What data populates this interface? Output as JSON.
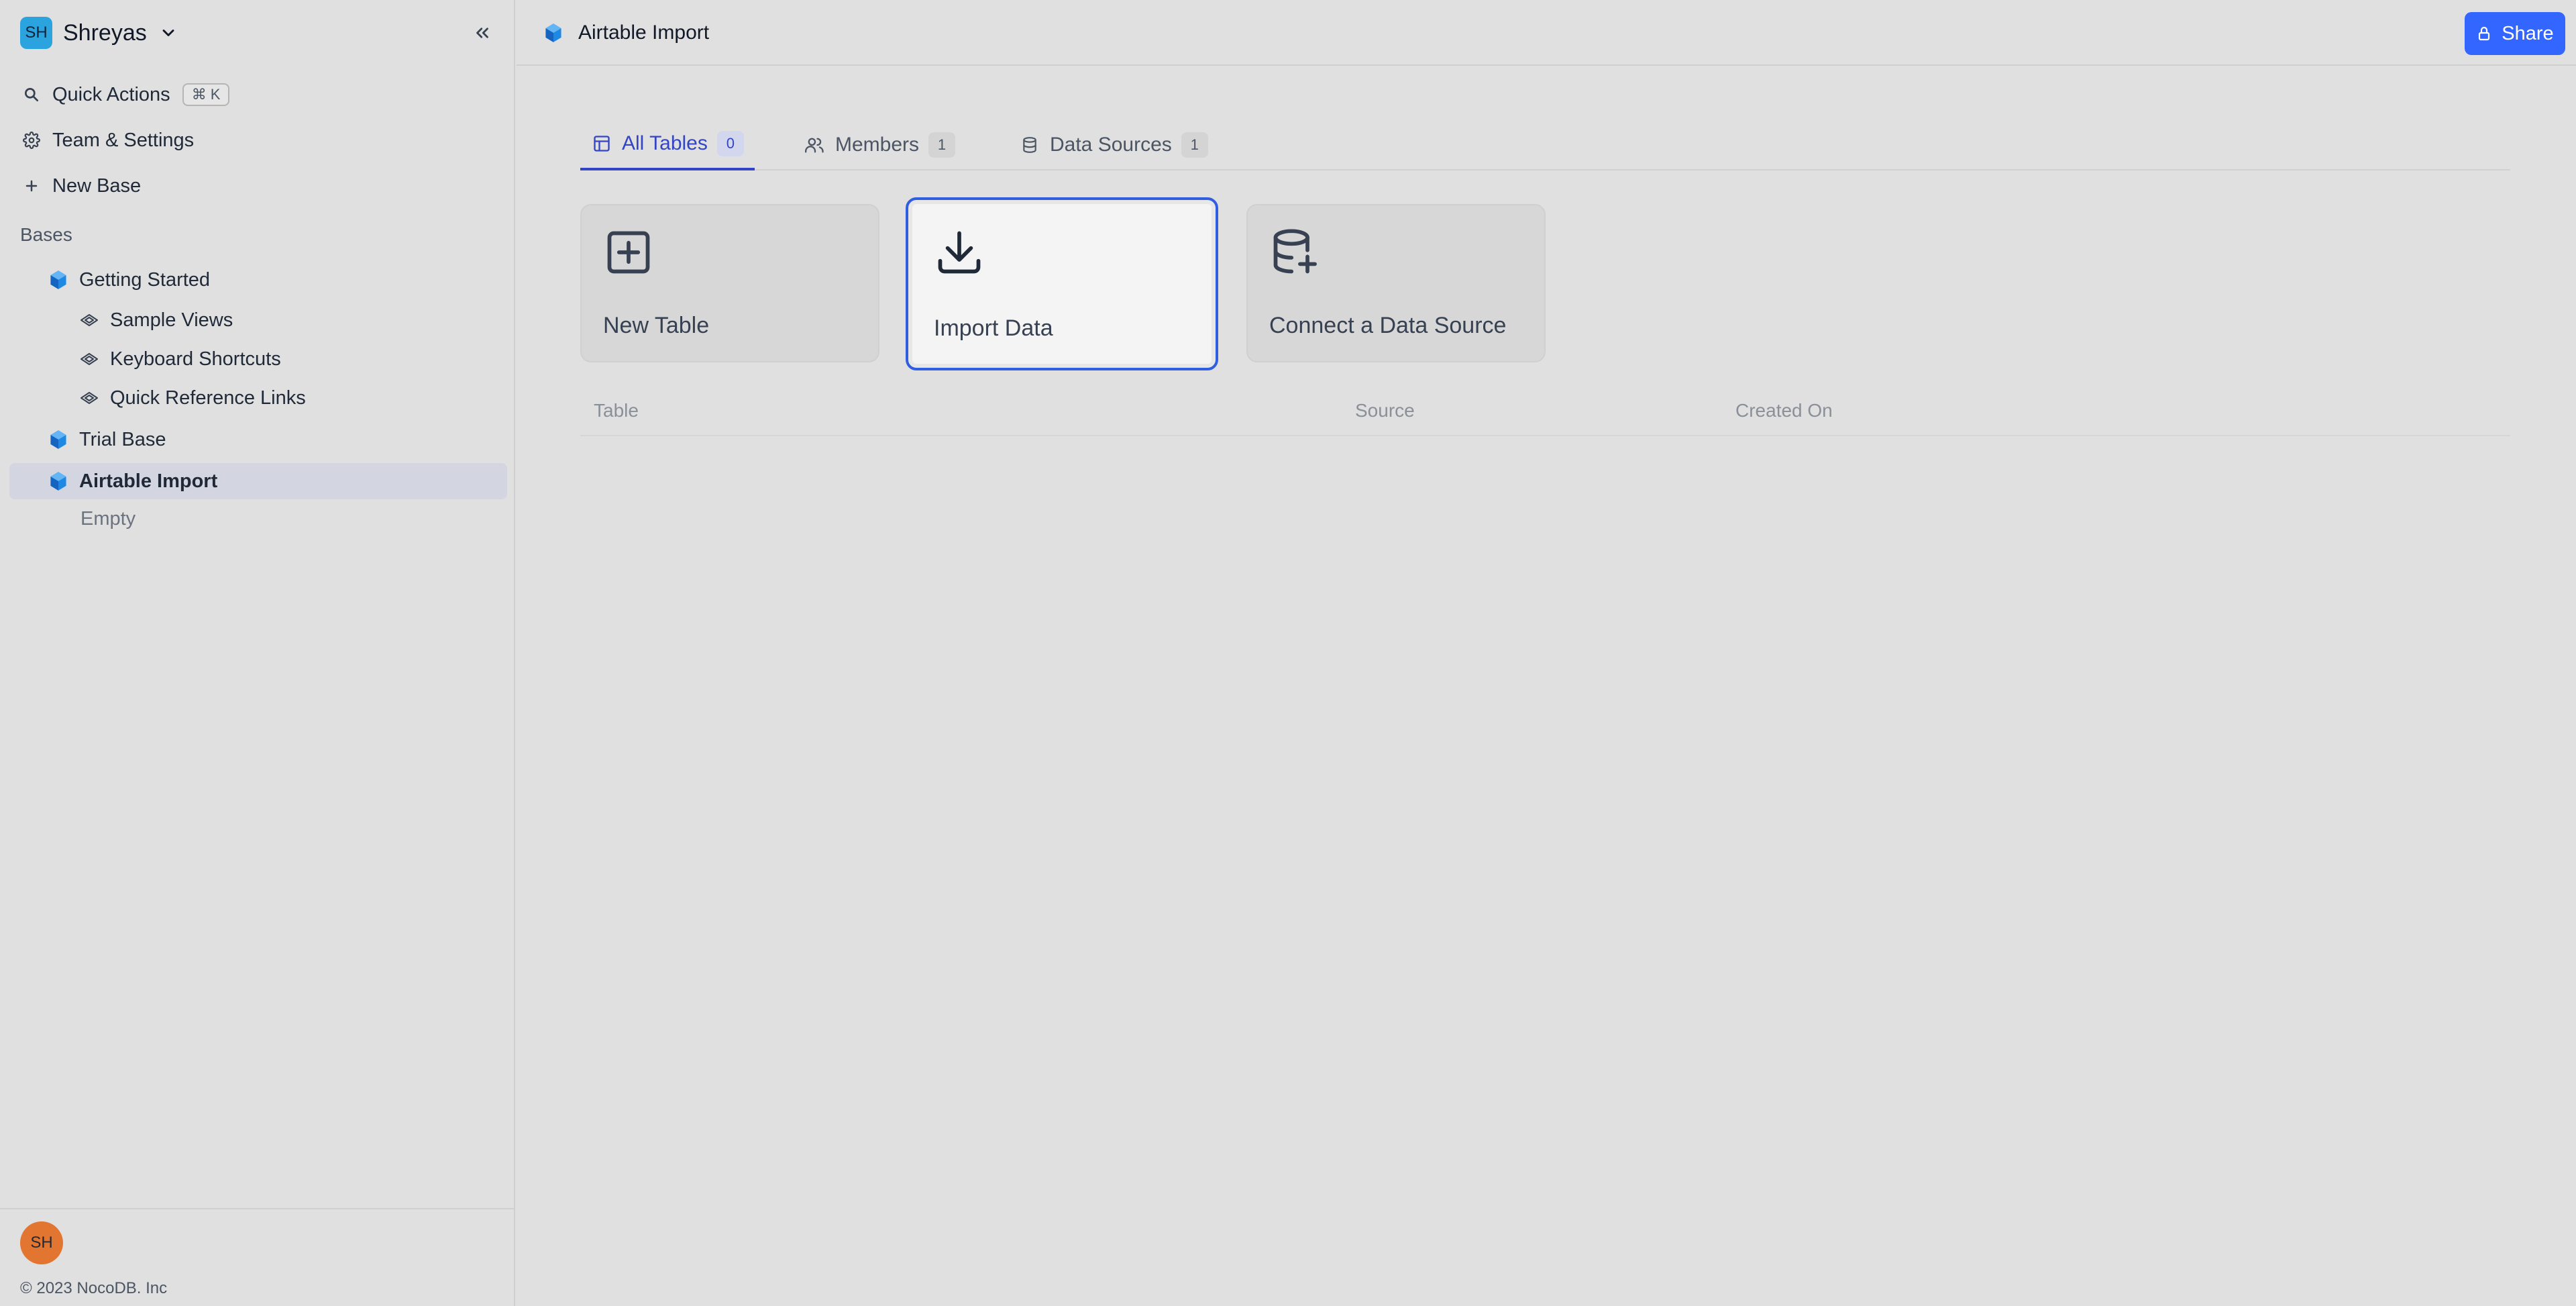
{
  "workspace": {
    "initials": "SH",
    "name": "Shreyas"
  },
  "nav": {
    "quick_actions": "Quick Actions",
    "quick_actions_shortcut": "⌘ K",
    "team_settings": "Team & Settings",
    "new_base": "New Base"
  },
  "bases_label": "Bases",
  "tree": {
    "getting_started": "Getting Started",
    "sample_views": "Sample Views",
    "keyboard_shortcuts": "Keyboard Shortcuts",
    "quick_reference_links": "Quick Reference Links",
    "trial_base": "Trial Base",
    "airtable_import": "Airtable Import",
    "empty": "Empty"
  },
  "footer": {
    "user_initials": "SH",
    "copyright": "© 2023 NocoDB. Inc"
  },
  "topbar": {
    "title": "Airtable Import",
    "share_label": "Share"
  },
  "tabs": [
    {
      "label": "All Tables",
      "count": "0"
    },
    {
      "label": "Members",
      "count": "1"
    },
    {
      "label": "Data Sources",
      "count": "1"
    }
  ],
  "cards": {
    "new_table": "New Table",
    "import_data": "Import Data",
    "connect_source": "Connect a Data Source"
  },
  "table_headers": {
    "table": "Table",
    "source": "Source",
    "created_on": "Created On"
  },
  "colors": {
    "accent": "#3366ff",
    "active_tab": "#3345c4",
    "base_icon": "#1e88e5",
    "user_avatar": "#e2752f"
  }
}
